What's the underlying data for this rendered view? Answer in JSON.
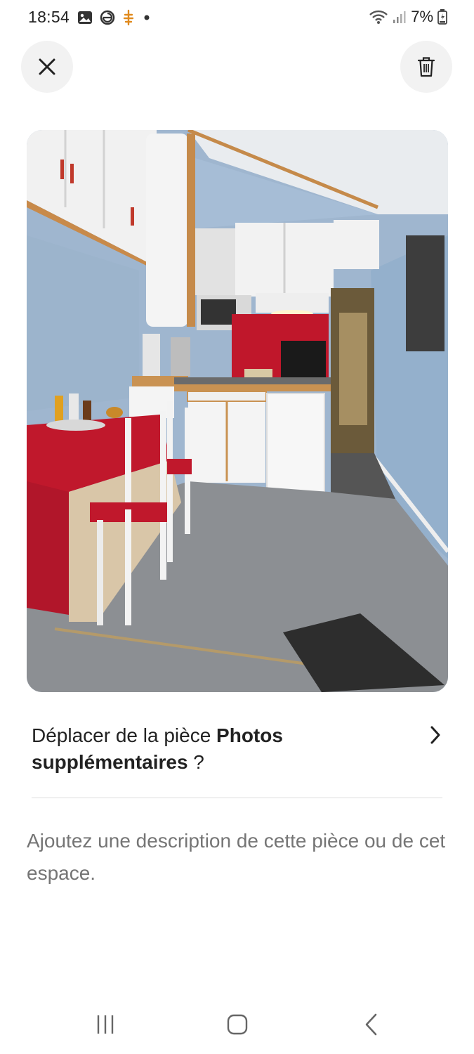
{
  "status_bar": {
    "time": "18:54",
    "battery": "7%",
    "icons_left": [
      "gallery-icon",
      "browser-icon",
      "notification-icon",
      "dot-icon"
    ],
    "icons_right": [
      "wifi-icon",
      "signal-icon",
      "battery-icon"
    ]
  },
  "header": {
    "close_icon": "close-icon",
    "delete_icon": "trash-icon"
  },
  "photo": {
    "subject": "kitchen room photo"
  },
  "move_room": {
    "prefix": "Déplacer de la pièce ",
    "room_name": "Photos supplémentaires",
    "suffix": " ?"
  },
  "description": {
    "placeholder": "Ajoutez une description de cette pièce ou de cet espace."
  },
  "nav_bar": {
    "items": [
      "recent-apps-icon",
      "home-icon",
      "back-icon"
    ]
  },
  "colors": {
    "text_primary": "#222222",
    "text_secondary": "#717171",
    "button_bg": "#f2f2f2",
    "divider": "#dddddd"
  }
}
